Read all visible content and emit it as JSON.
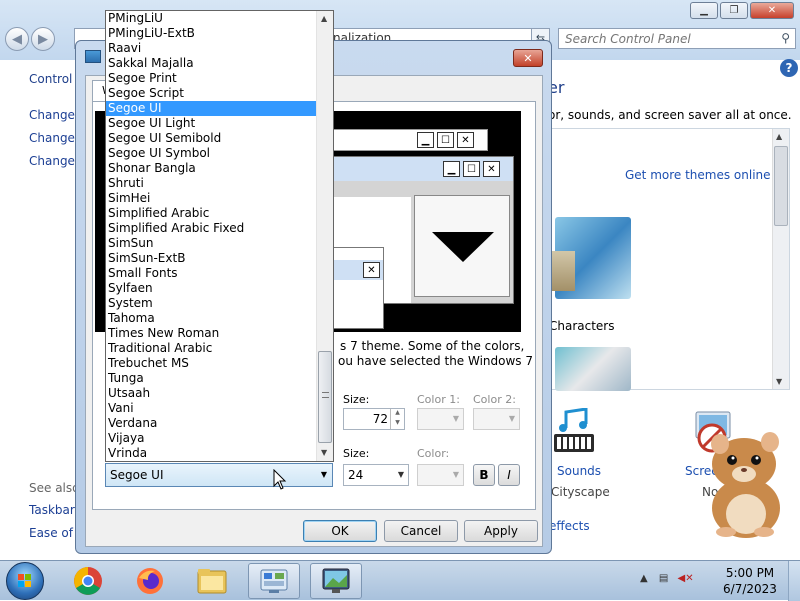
{
  "control_panel": {
    "address_text": "nalization",
    "search_placeholder": "Search Control Panel",
    "side_home": "Control P",
    "side_links": [
      "Change",
      "Change",
      "Change y"
    ],
    "see_also": "See also",
    "see_also_links": [
      "Taskbar a",
      "Ease of A"
    ],
    "title_fragment": "er",
    "desc_fragment": "or, sounds, and screen saver all at once.",
    "get_more_themes": "Get more themes online",
    "characters_label": "Characters",
    "sounds_label": "Sounds",
    "sounds_sub": "Cityscape",
    "screen_label": "Screen",
    "screen_sub": "No",
    "effects_link": "effects"
  },
  "dialog": {
    "tab_fragment": "W",
    "desc_line1": "s 7 theme.  Some of the colors,",
    "desc_line2": "ou have selected the Windows 7",
    "size_label_1": "Size:",
    "size_value_1": "72",
    "color1_label": "Color 1:",
    "color2_label": "Color 2:",
    "size_label_2": "Size:",
    "size_value_2": "24",
    "color_label": "Color:",
    "bold_label": "B",
    "italic_label": "I",
    "ok_label": "OK",
    "cancel_label": "Cancel",
    "apply_label": "Apply",
    "font_selected": "Segoe UI"
  },
  "font_list": {
    "selected": "Segoe UI",
    "items": [
      "PMingLiU",
      "PMingLiU-ExtB",
      "Raavi",
      "Sakkal Majalla",
      "Segoe Print",
      "Segoe Script",
      "Segoe UI",
      "Segoe UI Light",
      "Segoe UI Semibold",
      "Segoe UI Symbol",
      "Shonar Bangla",
      "Shruti",
      "SimHei",
      "Simplified Arabic",
      "Simplified Arabic Fixed",
      "SimSun",
      "SimSun-ExtB",
      "Small Fonts",
      "Sylfaen",
      "System",
      "Tahoma",
      "Times New Roman",
      "Traditional Arabic",
      "Trebuchet MS",
      "Tunga",
      "Utsaah",
      "Vani",
      "Verdana",
      "Vijaya",
      "Vrinda"
    ]
  },
  "taskbar": {
    "apps": [
      "chrome-icon",
      "firefox-icon",
      "file-explorer-icon",
      "control-panel-icon",
      "display-settings-icon"
    ],
    "time": "5:00 PM",
    "date": "6/7/2023"
  },
  "colors": {
    "selection": "#3399ff",
    "link": "#1c4fb0",
    "taskbar": "#a8c1dc"
  }
}
